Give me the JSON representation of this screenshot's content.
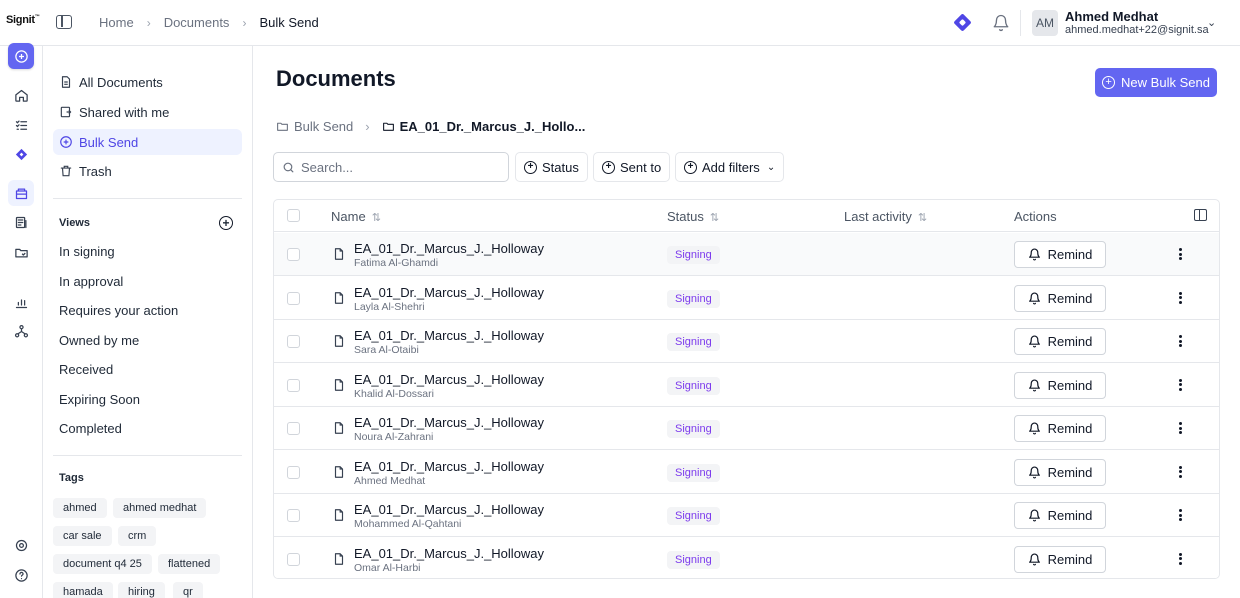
{
  "app": {
    "logo_text": "Signit",
    "logo_mark": "™"
  },
  "topbar": {
    "breadcrumb": [
      "Home",
      "Documents",
      "Bulk Send"
    ],
    "user": {
      "initials": "AM",
      "name": "Ahmed Medhat",
      "email": "ahmed.medhat+22@signit.sa"
    }
  },
  "rail": {
    "icons": [
      "add-circle-icon",
      "home-icon",
      "list-check-icon",
      "diamond-icon",
      "documents-icon",
      "templates-icon",
      "folders-icon",
      "analytics-icon",
      "workflow-icon",
      "settings-icon",
      "help-icon"
    ]
  },
  "sidebar": {
    "nav": [
      {
        "label": "All Documents",
        "icon": "files-icon"
      },
      {
        "label": "Shared with me",
        "icon": "share-icon"
      },
      {
        "label": "Bulk Send",
        "icon": "bulk-send-icon",
        "active": true
      },
      {
        "label": "Trash",
        "icon": "trash-icon"
      }
    ],
    "views_title": "Views",
    "views": [
      "In signing",
      "In approval",
      "Requires your action",
      "Owned by me",
      "Received",
      "Expiring Soon",
      "Completed"
    ],
    "tags_title": "Tags",
    "tags": [
      "ahmed",
      "ahmed medhat",
      "car sale",
      "crm",
      "document q4 25",
      "flattened",
      "hamada",
      "hiring",
      "qr"
    ]
  },
  "main": {
    "title": "Documents",
    "new_button": "New Bulk Send",
    "crumbs": [
      "Bulk Send",
      "EA_01_Dr._Marcus_J._Hollo..."
    ],
    "search_placeholder": "Search...",
    "filters": {
      "status": "Status",
      "sent_to": "Sent to",
      "add": "Add filters"
    },
    "columns": {
      "name": "Name",
      "status": "Status",
      "last_activity": "Last activity",
      "actions": "Actions"
    },
    "remind_label": "Remind",
    "rows": [
      {
        "name": "EA_01_Dr._Marcus_J._Holloway",
        "recipient": "Fatima Al-Ghamdi",
        "status": "Signing"
      },
      {
        "name": "EA_01_Dr._Marcus_J._Holloway",
        "recipient": "Layla Al-Shehri",
        "status": "Signing"
      },
      {
        "name": "EA_01_Dr._Marcus_J._Holloway",
        "recipient": "Sara Al-Otaibi",
        "status": "Signing"
      },
      {
        "name": "EA_01_Dr._Marcus_J._Holloway",
        "recipient": "Khalid Al-Dossari",
        "status": "Signing"
      },
      {
        "name": "EA_01_Dr._Marcus_J._Holloway",
        "recipient": "Noura Al-Zahrani",
        "status": "Signing"
      },
      {
        "name": "EA_01_Dr._Marcus_J._Holloway",
        "recipient": "Ahmed Medhat",
        "status": "Signing"
      },
      {
        "name": "EA_01_Dr._Marcus_J._Holloway",
        "recipient": "Mohammed Al-Qahtani",
        "status": "Signing"
      },
      {
        "name": "EA_01_Dr._Marcus_J._Holloway",
        "recipient": "Omar Al-Harbi",
        "status": "Signing"
      }
    ]
  },
  "colors": {
    "accent": "#6366f1",
    "status_text": "#7c3aed",
    "active_bg": "#eef2ff"
  }
}
